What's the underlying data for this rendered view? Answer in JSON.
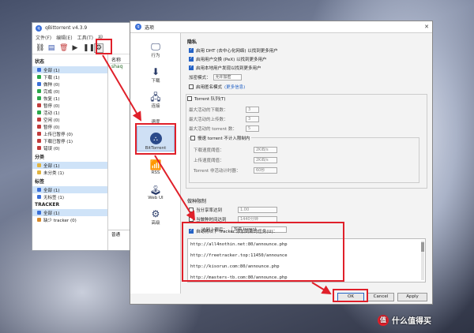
{
  "qbt": {
    "title": "qBittorrent v4.3.9",
    "menu": [
      "文件(F)",
      "编辑(E)",
      "工具(T)",
      "视"
    ],
    "status_head": "状态",
    "status": [
      {
        "label": "全部 (1)",
        "color": "#3a6fd8"
      },
      {
        "label": "下载 (1)",
        "color": "#2aa84a"
      },
      {
        "label": "做种 (0)",
        "color": "#3a6fd8"
      },
      {
        "label": "完成 (0)",
        "color": "#2aa84a"
      },
      {
        "label": "恢复 (1)",
        "color": "#2aa84a"
      },
      {
        "label": "暂停 (0)",
        "color": "#c23b3b"
      },
      {
        "label": "活动 (1)",
        "color": "#2aa84a"
      },
      {
        "label": "空闲 (0)",
        "color": "#c23b3b"
      },
      {
        "label": "暂停 (0)",
        "color": "#c23b3b"
      },
      {
        "label": "上传已暂停 (0)",
        "color": "#c23b3b"
      },
      {
        "label": "下载已暂停 (1)",
        "color": "#c23b3b"
      },
      {
        "label": "错误 (0)",
        "color": "#c23b3b"
      }
    ],
    "cat_head": "分类",
    "categories": [
      "全部 (1)",
      "未分类 (1)"
    ],
    "tag_head": "标签",
    "tags": [
      "全部 (1)",
      "无标签 (1)"
    ],
    "tracker_head": "TRACKER",
    "trackers": [
      "全部 (1)",
      "缺少 tracker (0)"
    ],
    "col_name": "名称",
    "row_name": "shaq",
    "bottom_label": "普通"
  },
  "dialog": {
    "title": "选项",
    "nav": [
      {
        "label": "行为",
        "icon": "🖵"
      },
      {
        "label": "下载",
        "icon": "⬇"
      },
      {
        "label": "连接",
        "icon": "🖧"
      },
      {
        "label": "速度",
        "icon": "◷"
      },
      {
        "label": "BitTorrent",
        "icon": "bt"
      },
      {
        "label": "RSS",
        "icon": "📶"
      },
      {
        "label": "Web UI",
        "icon": "🕹"
      },
      {
        "label": "高级",
        "icon": "⚙"
      }
    ],
    "privacy_title": "隐私",
    "privacy_opts": [
      "启用 DHT (去中心化网络) 以找到更多用户",
      "启用用户交换 (PeX) 以找到更多用户",
      "启用本地用户发现以找到更多用户"
    ],
    "encryption_label": "加密模式：",
    "encryption_value": "允许加密",
    "anon_label": "启用匿名模式",
    "anon_link": "(更多信息)",
    "queue_label": "Torrent 队列(T)",
    "queue_fields": [
      {
        "label": "最大活动的下载数：",
        "value": "3"
      },
      {
        "label": "最大活动的上传数：",
        "value": "3"
      },
      {
        "label": "最大活动的 torrent 数：",
        "value": "5"
      }
    ],
    "slow_label": "慢速 torrent 不计入限制内",
    "slow_fields": [
      {
        "label": "下载速度阈值：",
        "value": "2KiB/s"
      },
      {
        "label": "上传速度阈值：",
        "value": "2KiB/s"
      },
      {
        "label": "Torrent 非活动计时器：",
        "value": "60秒"
      }
    ],
    "seed_title": "做种限制",
    "seed_ratio_label": "当分享率达到",
    "seed_ratio_value": "1.00",
    "seed_time_label": "当做种时间达到",
    "seed_time_value": "1440分钟",
    "seed_action_label": "达到上限后：",
    "seed_action_value": "暂停 torrent",
    "tracker_check_label": "自动将以下 Tracker 添加到新的任务(U)：",
    "tracker_urls": [
      "http://all4nothin.net:80/announce.php",
      "http://freetracker.top:11450/announce",
      "http://kisorun.com:80/announce.php",
      "http://masters-tb.com:80/announce.php"
    ],
    "ok": "OK",
    "cancel": "Cancel",
    "apply": "Apply"
  },
  "watermark": "什么值得买",
  "watermark_logo": "值",
  "annotation_color": "#e0202a"
}
